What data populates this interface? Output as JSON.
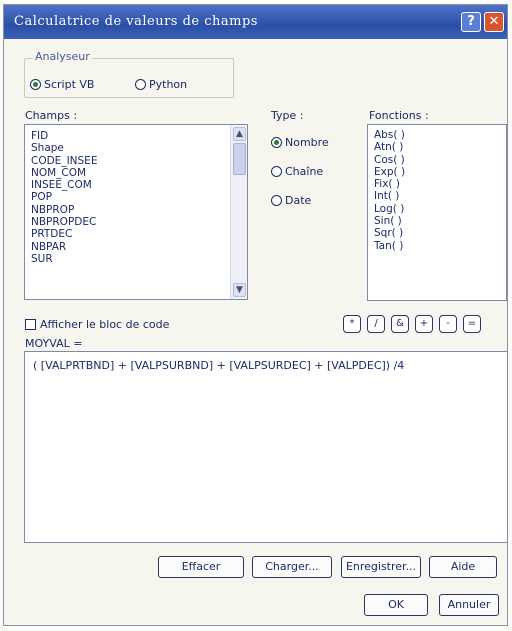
{
  "window": {
    "title": "Calculatrice de valeurs de champs",
    "help_label": "?",
    "close_label": "✕"
  },
  "parser": {
    "label": "Analyseur",
    "options": [
      "Script VB",
      "Python"
    ],
    "selected": "Script VB"
  },
  "fields": {
    "label": "Champs :",
    "items": [
      "FID",
      "Shape",
      "CODE_INSEE",
      "NOM_COM",
      "INSEE_COM",
      "POP",
      "NBPROP",
      "NBPROPDEC",
      "PRTDEC",
      "NBPAR",
      "SUR"
    ]
  },
  "type": {
    "label": "Type :",
    "options": [
      "Nombre",
      "Chaîne",
      "Date"
    ],
    "selected": "Nombre"
  },
  "functions": {
    "label": "Fonctions :",
    "items": [
      "Abs( )",
      "Atn( )",
      "Cos( )",
      "Exp( )",
      "Fix( )",
      "Int( )",
      "Log( )",
      "Sin( )",
      "Sqr( )",
      "Tan( )"
    ]
  },
  "code_block": {
    "label": "Afficher le bloc de code",
    "checked": false
  },
  "operators": [
    "*",
    "/",
    "&",
    "+",
    "-",
    "="
  ],
  "expression": {
    "label": "MOYVAL =",
    "value": "( [VALPRTBND] + [VALPSURBND] + [VALPSURDEC] + [VALPDEC]) /4"
  },
  "buttons": {
    "clear": "Effacer",
    "load": "Charger...",
    "save": "Enregistrer...",
    "help": "Aide",
    "ok": "OK",
    "cancel": "Annuler"
  }
}
